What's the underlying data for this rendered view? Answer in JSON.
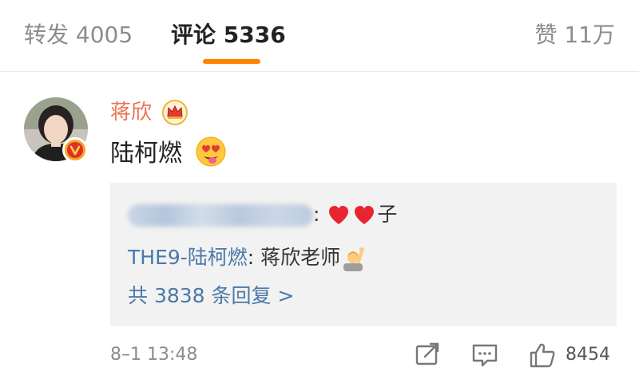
{
  "tabs": {
    "repost": "转发 4005",
    "comments": "评论 5336",
    "likes": "赞 11万"
  },
  "colors": {
    "accent": "#ff8200",
    "author_name": "#eb7350",
    "link": "#4a79a8",
    "reply_box_bg": "#f2f2f2"
  },
  "comment": {
    "author": "蒋欣",
    "author_badge_icon": "crown-icon",
    "avatar_badge_icon": "verified-v-icon",
    "text": "陆柯燃",
    "text_emoji_icon": "heart-eyes-emoji-icon",
    "time": "8–1 13:48",
    "like_count": "8454"
  },
  "replies": [
    {
      "author_blurred": true,
      "separator": ": ",
      "text_after_emoji": "子",
      "emoji_icons": [
        "red-heart-icon",
        "red-heart-icon"
      ]
    },
    {
      "author": "THE9-陆柯燃",
      "separator": ": ",
      "text": "蒋欣老师",
      "emoji_icon": "raising-hand-emoji-icon"
    }
  ],
  "more_replies": "共 3838 条回复 >",
  "actions": [
    "repost-icon",
    "comment-icon",
    "like-icon"
  ]
}
